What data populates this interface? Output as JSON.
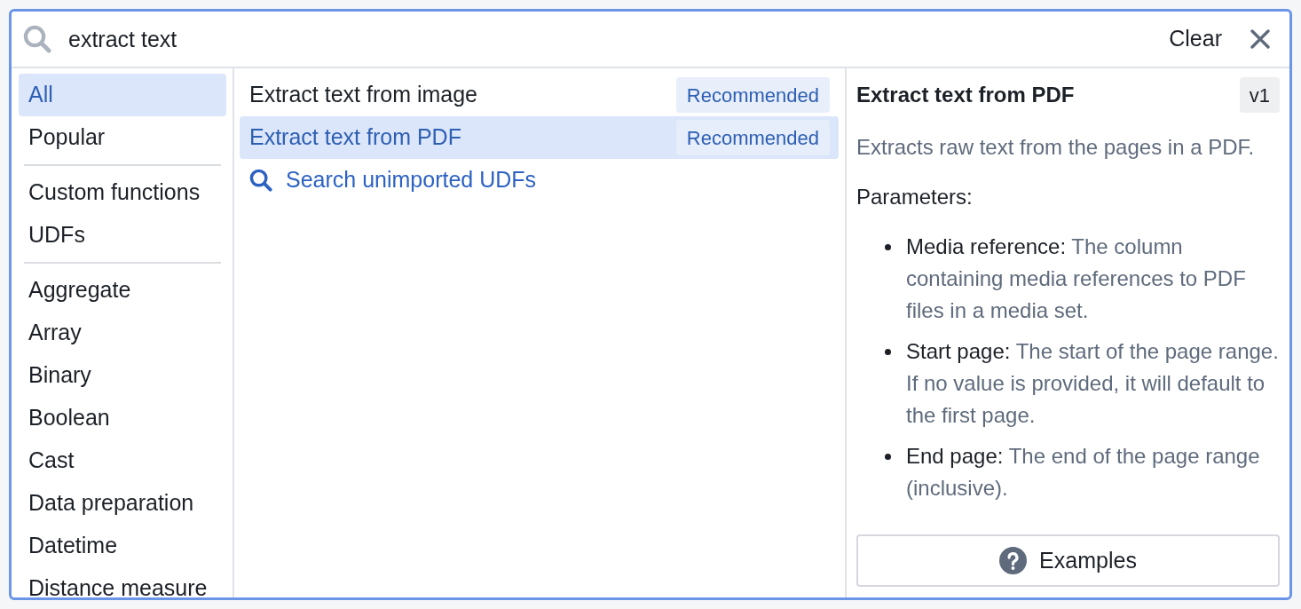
{
  "search": {
    "value": "extract text",
    "clear_label": "Clear"
  },
  "categories": [
    {
      "items": [
        {
          "label": "All",
          "selected": true
        },
        {
          "label": "Popular",
          "selected": false
        }
      ]
    },
    {
      "items": [
        {
          "label": "Custom functions",
          "selected": false
        },
        {
          "label": "UDFs",
          "selected": false
        }
      ]
    },
    {
      "items": [
        {
          "label": "Aggregate",
          "selected": false
        },
        {
          "label": "Array",
          "selected": false
        },
        {
          "label": "Binary",
          "selected": false
        },
        {
          "label": "Boolean",
          "selected": false
        },
        {
          "label": "Cast",
          "selected": false
        },
        {
          "label": "Data preparation",
          "selected": false
        },
        {
          "label": "Datetime",
          "selected": false
        },
        {
          "label": "Distance measure",
          "selected": false
        }
      ]
    }
  ],
  "results": [
    {
      "kind": "function",
      "label": "Extract text from image",
      "badge": "Recommended",
      "selected": false
    },
    {
      "kind": "function",
      "label": "Extract text from PDF",
      "badge": "Recommended",
      "selected": true
    },
    {
      "kind": "search_link",
      "label": "Search unimported UDFs"
    }
  ],
  "detail": {
    "title": "Extract text from PDF",
    "version": "v1",
    "description": "Extracts raw text from the pages in a PDF.",
    "parameters_heading": "Parameters:",
    "parameters": [
      {
        "name": "Media reference:",
        "description": "The column containing media references to PDF files in a media set."
      },
      {
        "name": "Start page:",
        "description": "The start of the page range. If no value is provided, it will default to the first page."
      },
      {
        "name": "End page:",
        "description": "The end of the page range (inclusive)."
      }
    ],
    "examples_button": "Examples"
  }
}
